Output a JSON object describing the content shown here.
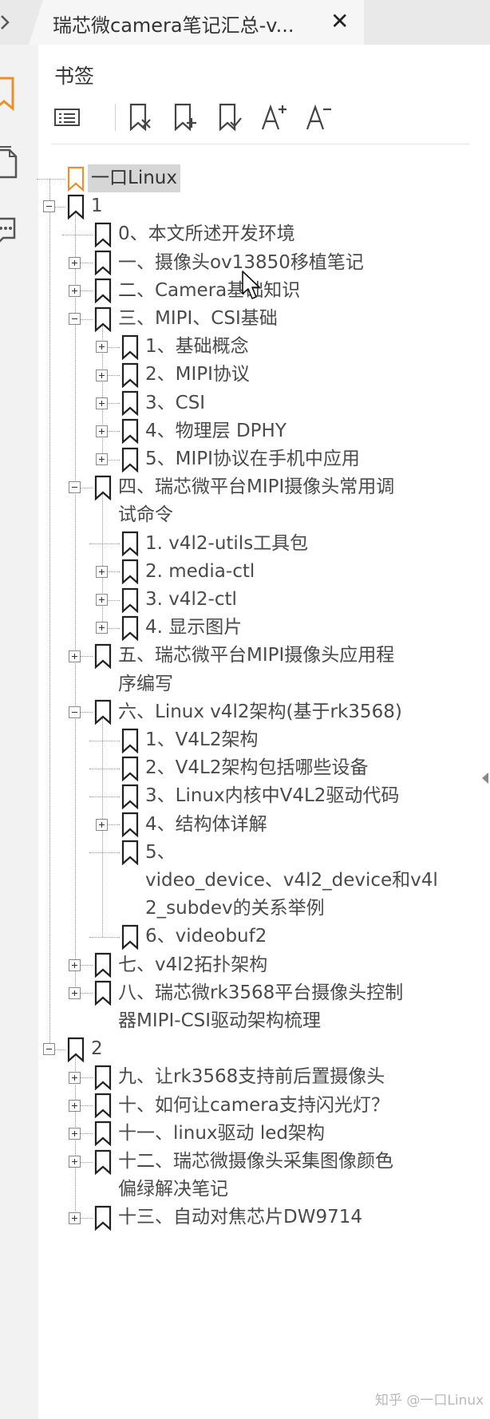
{
  "tab": {
    "title": "瑞芯微camera笔记汇总-v...",
    "close_glyph": "✕"
  },
  "panel": {
    "title": "书签"
  },
  "toolbar": {
    "icons": [
      "bookmark-options-icon",
      "delete-bookmark-icon",
      "add-bookmark-icon",
      "bookmark-check-icon",
      "increase-font-icon",
      "decrease-font-icon"
    ]
  },
  "colors": {
    "accent_orange": "#e8902c",
    "selected_bg": "#d6d6d6",
    "text": "#4a4a4a"
  },
  "tree": [
    {
      "label": "一口Linux",
      "selected": true,
      "exp": null,
      "accent": true
    },
    {
      "label": "1",
      "exp": "minus"
    },
    {
      "label": "0、本文所述开发环境",
      "exp": null
    },
    {
      "label": "一、摄像头ov13850移植笔记",
      "exp": "plus"
    },
    {
      "label": "二、Camera基础知识",
      "exp": "plus"
    },
    {
      "label": "三、MIPI、CSI基础",
      "exp": "minus"
    },
    {
      "label": "1、基础概念",
      "exp": "plus"
    },
    {
      "label": "2、MIPI协议",
      "exp": "plus"
    },
    {
      "label": "3、CSI",
      "exp": "plus"
    },
    {
      "label": "4、物理层 DPHY",
      "exp": "plus"
    },
    {
      "label": "5、MIPI协议在手机中应用",
      "exp": "plus"
    },
    {
      "label": "四、瑞芯微平台MIPI摄像头常用调",
      "label2": "试命令",
      "exp": "minus"
    },
    {
      "label": "1. v4l2-utils工具包",
      "exp": null
    },
    {
      "label": "2. media-ctl",
      "exp": "plus"
    },
    {
      "label": "3. v4l2-ctl",
      "exp": "plus"
    },
    {
      "label": "4. 显示图片",
      "exp": "plus"
    },
    {
      "label": "五、瑞芯微平台MIPI摄像头应用程",
      "label2": "序编写",
      "exp": "plus"
    },
    {
      "label": "六、Linux v4l2架构(基于rk3568)",
      "exp": "minus"
    },
    {
      "label": "1、V4L2架构",
      "exp": null
    },
    {
      "label": "2、V4L2架构包括哪些设备",
      "exp": null
    },
    {
      "label": "3、Linux内核中V4L2驱动代码",
      "exp": null
    },
    {
      "label": "4、结构体详解",
      "exp": "plus"
    },
    {
      "label": "5、",
      "label2": "video_device、v4l2_device和v4l",
      "label3": "2_subdev的关系举例",
      "exp": null
    },
    {
      "label": "6、videobuf2",
      "exp": null
    },
    {
      "label": "七、v4l2拓扑架构",
      "exp": "plus"
    },
    {
      "label": "八、瑞芯微rk3568平台摄像头控制",
      "label2": "器MIPI-CSI驱动架构梳理",
      "exp": "plus"
    },
    {
      "label": "2",
      "exp": "minus"
    },
    {
      "label": "九、让rk3568支持前后置摄像头",
      "exp": "plus"
    },
    {
      "label": "十、如何让camera支持闪光灯？",
      "exp": "plus"
    },
    {
      "label": "十一、linux驱动 led架构",
      "exp": "plus"
    },
    {
      "label": "十二、瑞芯微摄像头采集图像颜色",
      "label2": "偏绿解决笔记",
      "exp": "plus"
    },
    {
      "label": "十三、自动对焦芯片DW9714",
      "exp": "plus"
    }
  ],
  "watermark": "知乎 @一口Linux"
}
